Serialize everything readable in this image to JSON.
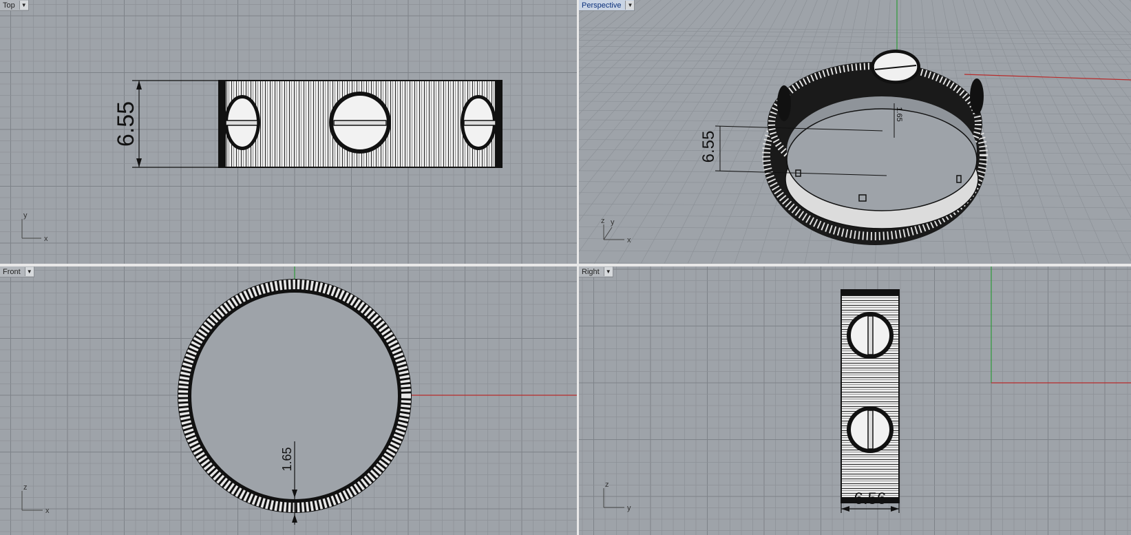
{
  "viewports": {
    "top": {
      "label": "Top",
      "active": false,
      "axis": [
        "y",
        "x"
      ]
    },
    "perspective": {
      "label": "Perspective",
      "active": true,
      "axis": [
        "z",
        "y",
        "x"
      ]
    },
    "front": {
      "label": "Front",
      "active": false,
      "axis": [
        "z",
        "x"
      ]
    },
    "right": {
      "label": "Right",
      "active": false,
      "axis": [
        "z",
        "y"
      ]
    }
  },
  "dimensions": {
    "top_width": "6.55",
    "perspective_width": "6.55",
    "perspective_thickness": "1.65",
    "front_thickness": "1.65",
    "right_width": "6.56"
  },
  "icons": {
    "dropdown": "chevron-down-icon"
  },
  "colors": {
    "viewport_bg": "#9ea3a9",
    "grid_minor": "#8c9197",
    "grid_major": "#7d8288",
    "x_axis": "#b82a2a",
    "y_axis": "#2f9a3a",
    "ring_stroke": "#111111",
    "ring_fill": "#e9e9e9"
  }
}
